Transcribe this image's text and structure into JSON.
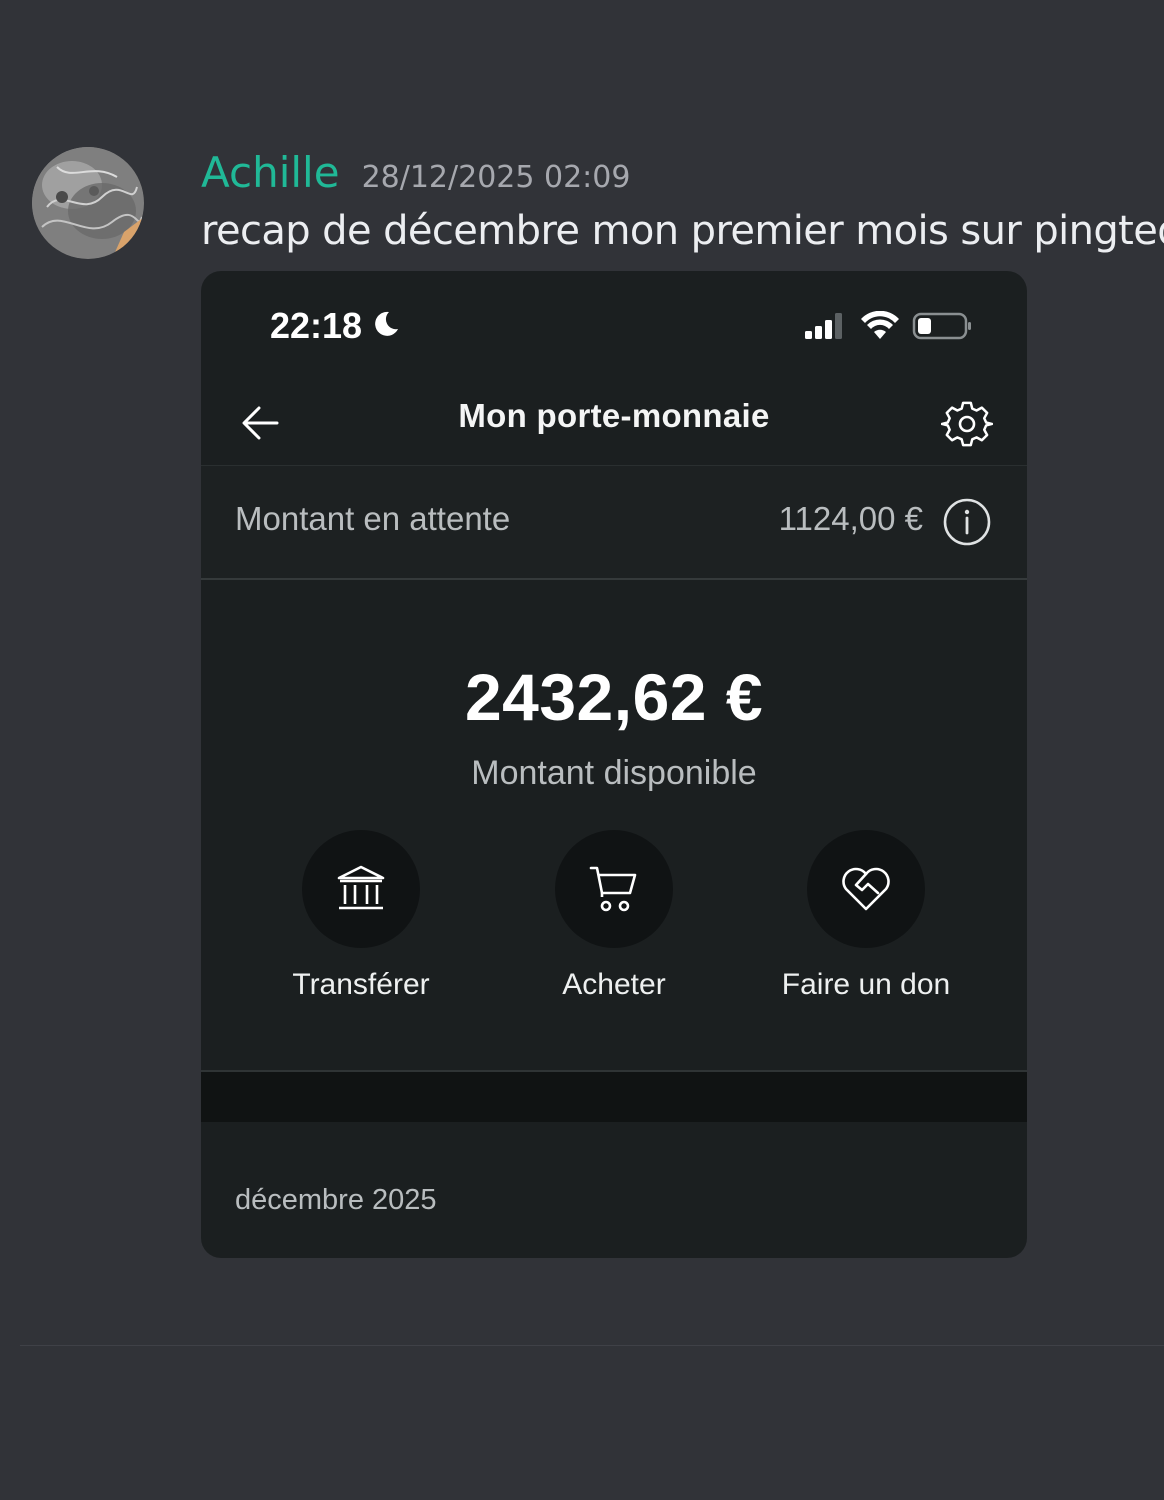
{
  "message": {
    "author": "Achille",
    "timestamp": "28/12/2025 02:09",
    "text": "recap de décembre mon premier mois sur pingted",
    "author_color": "#20b997"
  },
  "phone": {
    "status_bar": {
      "time": "22:18",
      "icons": [
        "moon-icon",
        "signal-icon",
        "wifi-icon",
        "battery-icon"
      ]
    },
    "nav": {
      "title": "Mon porte-monnaie",
      "back_icon": "arrow-left-icon",
      "settings_icon": "gear-icon"
    },
    "pending": {
      "label": "Montant en attente",
      "amount": "1124,00 €",
      "icon": "info-icon"
    },
    "balance": {
      "amount": "2432,62 €",
      "label": "Montant disponible"
    },
    "actions": [
      {
        "label": "Transférer",
        "icon": "bank-icon"
      },
      {
        "label": "Acheter",
        "icon": "cart-icon"
      },
      {
        "label": "Faire un don",
        "icon": "heart-handshake-icon"
      }
    ],
    "history": {
      "month": "décembre 2025"
    }
  },
  "colors": {
    "background": "#313338",
    "card": "#1b1f20",
    "accent": "#20b997"
  }
}
